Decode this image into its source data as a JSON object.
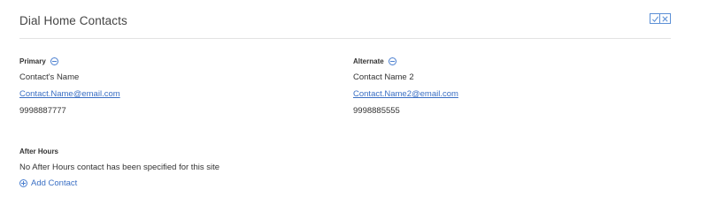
{
  "panel": {
    "title": "Dial Home Contacts",
    "actions": [
      {
        "name": "confirm",
        "icon": "check-icon"
      },
      {
        "name": "cancel",
        "icon": "close-icon"
      }
    ]
  },
  "primary": {
    "label": "Primary",
    "name": "Contact's Name",
    "email": "Contact.Name@email.com",
    "phone": "9998887777",
    "remove_icon": "minus-circle-icon"
  },
  "alternate": {
    "label": "Alternate",
    "name": "Contact Name 2",
    "email": "Contact.Name2@email.com",
    "phone": "9998885555",
    "remove_icon": "minus-circle-icon"
  },
  "after_hours": {
    "label": "After Hours",
    "note": "No After Hours contact has been specified for this site",
    "add_label": "Add Contact",
    "add_icon": "plus-circle-icon"
  },
  "colors": {
    "accent": "#3a6fc4",
    "divider": "#e3e3e3",
    "text": "#333333"
  }
}
